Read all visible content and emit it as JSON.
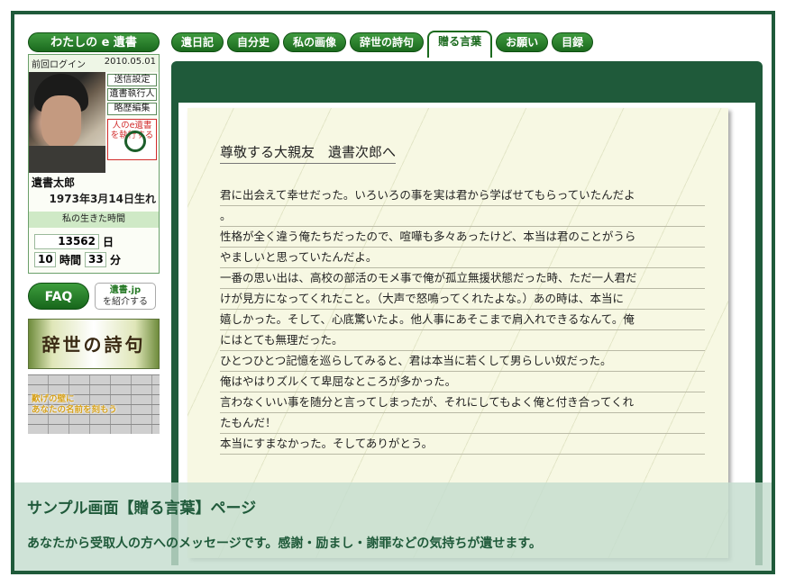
{
  "sidebar": {
    "title": "わたしの e 遺書",
    "last_login_label": "前回ログイン",
    "last_login_date": "2010.05.01",
    "buttons": [
      "送信設定",
      "遺書執行人",
      "略歴編集"
    ],
    "red_box_text": "人のe遺書を執行する",
    "name": "遺書太郎",
    "birth": "1973年3月14日生れ",
    "time_label": "私の生きた時間",
    "days_value": "13562",
    "days_unit": "日",
    "hours_value": "10",
    "hours_unit": "時間",
    "minutes_value": "33",
    "minutes_unit": "分",
    "faq_label": "FAQ",
    "intro_line1": "遺書.jp",
    "intro_line2": "を紹介する",
    "poem_banner": "辞世の詩句",
    "wall_line1": "歎げの壁に",
    "wall_line2": "あなたの名前を刻もう"
  },
  "tabs": [
    {
      "label": "遺日記",
      "active": false
    },
    {
      "label": "自分史",
      "active": false
    },
    {
      "label": "私の画像",
      "active": false
    },
    {
      "label": "辞世の詩句",
      "active": false
    },
    {
      "label": "贈る言葉",
      "active": true
    },
    {
      "label": "お願い",
      "active": false
    },
    {
      "label": "目録",
      "active": false
    }
  ],
  "letter": {
    "title": "尊敬する大親友　遺書次郎へ",
    "lines": [
      "君に出会えて幸せだった。いろいろの事を実は君から学ばせてもらっていたんだよ",
      "。",
      "性格が全く違う俺たちだったので、喧嘩も多々あったけど、本当は君のことがうら",
      "やましいと思っていたんだよ。",
      "一番の思い出は、高校の部活のモメ事で俺が孤立無援状態だった時、ただ一人君だ",
      "けが見方になってくれたこと。（大声で怒鳴ってくれたよな。）あの時は、本当に",
      "嬉しかった。そして、心底驚いたよ。他人事にあそこまで肩入れできるなんて。俺",
      "にはとても無理だった。",
      "ひとつひとつ記憶を巡らしてみると、君は本当に若くして男らしい奴だった。",
      "俺はやはりズルくて卑屈なところが多かった。",
      "言わなくいい事を随分と言ってしまったが、それにしてもよく俺と付き合ってくれ",
      "たもんだ！",
      "本当にすまなかった。そしてありがとう。"
    ]
  },
  "overlay": {
    "title": "サンプル画面【贈る言葉】ページ",
    "description": "あなたから受取人の方へのメッセージです。感謝・励まし・謝罪などの気持ちが遺せます。"
  }
}
